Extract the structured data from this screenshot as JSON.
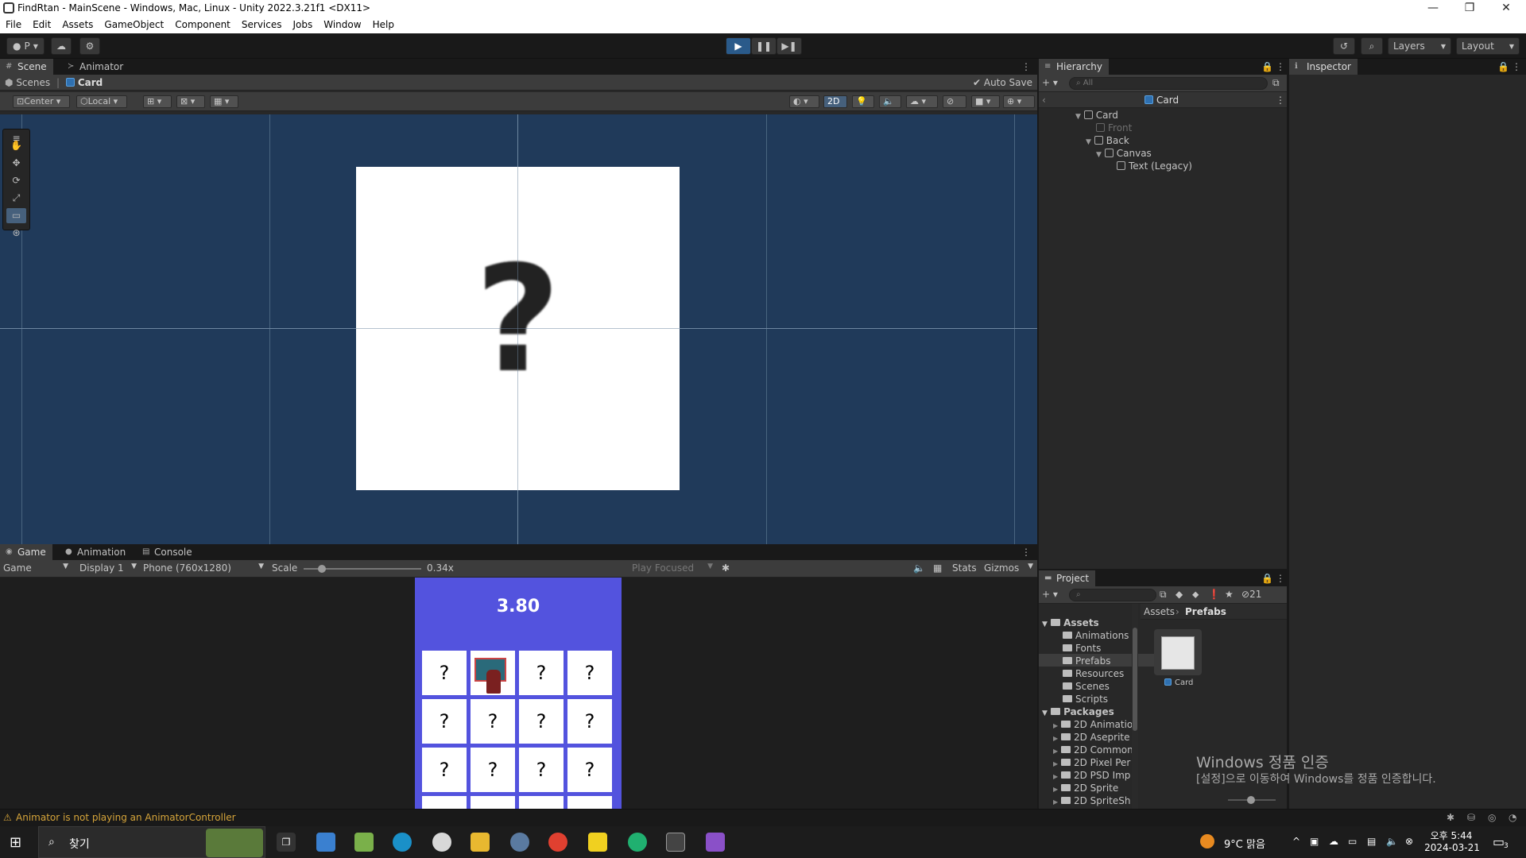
{
  "window": {
    "title": "FindRtan - MainScene - Windows, Mac, Linux - Unity 2022.3.21f1 <DX11>",
    "minimize": "—",
    "restore": "❐",
    "close": "✕"
  },
  "menu": [
    "File",
    "Edit",
    "Assets",
    "GameObject",
    "Component",
    "Services",
    "Jobs",
    "Window",
    "Help"
  ],
  "toolbar": {
    "account": "P",
    "layers": "Layers",
    "layout": "Layout"
  },
  "scene_panel": {
    "tabs": [
      "Scene",
      "Animator"
    ],
    "breadcrumb_root": "Scenes",
    "breadcrumb_item": "Card",
    "auto_save": "Auto Save",
    "pivot": "Center",
    "space": "Local",
    "mode_2d": "2D",
    "card_glyph": "?"
  },
  "game_panel": {
    "tabs": [
      "Game",
      "Animation",
      "Console"
    ],
    "view": "Game",
    "display": "Display 1",
    "resolution": "Phone (760x1280)",
    "scale_label": "Scale",
    "scale_value": "0.34x",
    "scale_fraction": 0.13,
    "play_focused": "Play Focused",
    "stats": "Stats",
    "gizmos": "Gizmos",
    "timer": "3.80",
    "card_glyph": "?"
  },
  "hierarchy": {
    "tab": "Hierarchy",
    "search_placeholder": "All",
    "header": "Card",
    "items": [
      {
        "label": "Card"
      },
      {
        "label": "Front"
      },
      {
        "label": "Back"
      },
      {
        "label": "Canvas"
      },
      {
        "label": "Text (Legacy)"
      }
    ]
  },
  "inspector": {
    "tab": "Inspector"
  },
  "project": {
    "tab": "Project",
    "hidden_count": "21",
    "breadcrumb_root": "Assets",
    "breadcrumb_current": "Prefabs",
    "assets_label": "Assets",
    "asset_folders": [
      "Animations",
      "Fonts",
      "Prefabs",
      "Resources",
      "Scenes",
      "Scripts"
    ],
    "packages_label": "Packages",
    "package_folders": [
      "2D Animatio",
      "2D Aseprite",
      "2D Common",
      "2D Pixel Per",
      "2D PSD Imp",
      "2D Sprite",
      "2D SpriteSh"
    ],
    "prefab_item": "Card"
  },
  "status": {
    "message": "Animator is not playing an AnimatorController"
  },
  "watermark": {
    "line1": "Windows 정품 인증",
    "line2": "[설정]으로 이동하여 Windows를 정품 인증합니다."
  },
  "taskbar": {
    "search": "찾기",
    "weather": "9°C 맑음",
    "time": "오후 5:44",
    "date": "2024-03-21",
    "notifications": "3"
  },
  "colors": {
    "scene_bg": "#203a5a",
    "game_bg": "#5353de",
    "accent": "#2a5a8a",
    "warning": "#d6a53a"
  }
}
